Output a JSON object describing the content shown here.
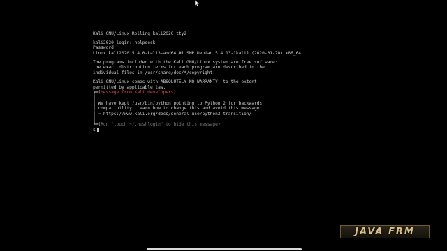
{
  "terminal": {
    "header": "Kali GNU/Linux Rolling kali2020 tty2",
    "login_line": "kali2020 login: helpdesk",
    "password_line": "Password:",
    "uname_line": "Linux kali2020 5.4.0-kali3-amd64 #1 SMP Debian 5.4.13-1kali1 (2020-01-20) x86_64",
    "programs_1": "The programs included with the Kali GNU/Linux system are free software:",
    "programs_2": "the exact distribution terms for each program are described in the",
    "programs_3": "individual files in /usr/share/doc/*/copyright.",
    "warranty_1": "Kali GNU/Linux comes with ABSOLUTELY NO WARRANTY, to the extent",
    "warranty_2": "permitted by applicable law.",
    "msg_prefix": "┏━(",
    "msg_text": "Message from Kali developers",
    "msg_suffix": ")",
    "bar_1": "┃",
    "python_1_prefix": "┃ ",
    "python_1": "We have kept /usr/bin/python pointing to Python 2 for backwards",
    "python_2_prefix": "┃ ",
    "python_2": "compatibility. Learn how to change this and avoid this message:",
    "python_3_prefix": "┃ ",
    "python_3": "⇒ https://www.kali.org/docs/general-use/python3-transition/",
    "bar_2": "┃",
    "hide_prefix": "┗━(",
    "hide_text": "Run \"touch ~/.hushlogin\" to hide this message",
    "hide_suffix": ")",
    "prompt": "$"
  },
  "watermark": {
    "text": "JAVA FRM"
  },
  "icons": {
    "mouse": "mouse-pointer-icon"
  }
}
